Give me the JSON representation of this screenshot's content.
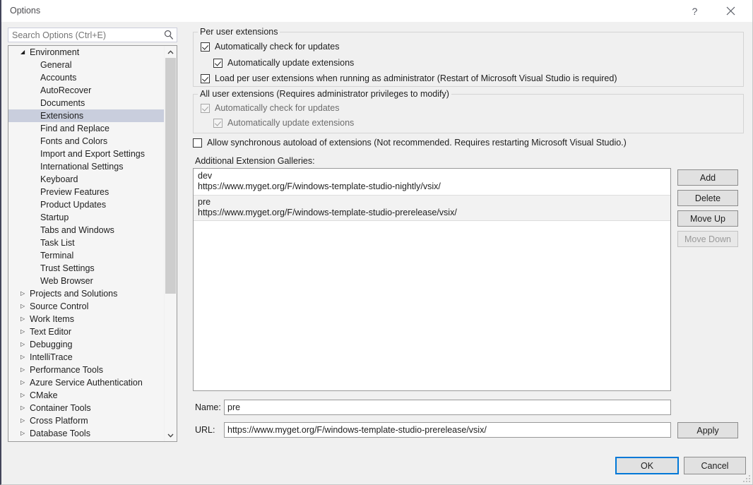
{
  "window": {
    "title": "Options",
    "help_icon": "question-mark-icon",
    "close_icon": "close-icon"
  },
  "search": {
    "placeholder": "Search Options (Ctrl+E)",
    "value": "",
    "icon": "search-icon"
  },
  "tree": {
    "items": [
      {
        "label": "Environment",
        "level": 0,
        "expanded": true,
        "arrow": "◢",
        "selected": false
      },
      {
        "label": "General",
        "level": 1,
        "arrow": "",
        "selected": false
      },
      {
        "label": "Accounts",
        "level": 1,
        "arrow": "",
        "selected": false
      },
      {
        "label": "AutoRecover",
        "level": 1,
        "arrow": "",
        "selected": false
      },
      {
        "label": "Documents",
        "level": 1,
        "arrow": "",
        "selected": false
      },
      {
        "label": "Extensions",
        "level": 1,
        "arrow": "",
        "selected": true
      },
      {
        "label": "Find and Replace",
        "level": 1,
        "arrow": "",
        "selected": false
      },
      {
        "label": "Fonts and Colors",
        "level": 1,
        "arrow": "",
        "selected": false
      },
      {
        "label": "Import and Export Settings",
        "level": 1,
        "arrow": "",
        "selected": false
      },
      {
        "label": "International Settings",
        "level": 1,
        "arrow": "",
        "selected": false
      },
      {
        "label": "Keyboard",
        "level": 1,
        "arrow": "",
        "selected": false
      },
      {
        "label": "Preview Features",
        "level": 1,
        "arrow": "",
        "selected": false
      },
      {
        "label": "Product Updates",
        "level": 1,
        "arrow": "",
        "selected": false
      },
      {
        "label": "Startup",
        "level": 1,
        "arrow": "",
        "selected": false
      },
      {
        "label": "Tabs and Windows",
        "level": 1,
        "arrow": "",
        "selected": false
      },
      {
        "label": "Task List",
        "level": 1,
        "arrow": "",
        "selected": false
      },
      {
        "label": "Terminal",
        "level": 1,
        "arrow": "",
        "selected": false
      },
      {
        "label": "Trust Settings",
        "level": 1,
        "arrow": "",
        "selected": false
      },
      {
        "label": "Web Browser",
        "level": 1,
        "arrow": "",
        "selected": false
      },
      {
        "label": "Projects and Solutions",
        "level": 0,
        "expanded": false,
        "arrow": "▷",
        "selected": false
      },
      {
        "label": "Source Control",
        "level": 0,
        "expanded": false,
        "arrow": "▷",
        "selected": false
      },
      {
        "label": "Work Items",
        "level": 0,
        "expanded": false,
        "arrow": "▷",
        "selected": false
      },
      {
        "label": "Text Editor",
        "level": 0,
        "expanded": false,
        "arrow": "▷",
        "selected": false
      },
      {
        "label": "Debugging",
        "level": 0,
        "expanded": false,
        "arrow": "▷",
        "selected": false
      },
      {
        "label": "IntelliTrace",
        "level": 0,
        "expanded": false,
        "arrow": "▷",
        "selected": false
      },
      {
        "label": "Performance Tools",
        "level": 0,
        "expanded": false,
        "arrow": "▷",
        "selected": false
      },
      {
        "label": "Azure Service Authentication",
        "level": 0,
        "expanded": false,
        "arrow": "▷",
        "selected": false
      },
      {
        "label": "CMake",
        "level": 0,
        "expanded": false,
        "arrow": "▷",
        "selected": false
      },
      {
        "label": "Container Tools",
        "level": 0,
        "expanded": false,
        "arrow": "▷",
        "selected": false
      },
      {
        "label": "Cross Platform",
        "level": 0,
        "expanded": false,
        "arrow": "▷",
        "selected": false
      },
      {
        "label": "Database Tools",
        "level": 0,
        "expanded": false,
        "arrow": "▷",
        "selected": false
      }
    ],
    "scroll_up_icon": "chevron-up-icon",
    "scroll_down_icon": "chevron-down-icon"
  },
  "per_user_group": {
    "label": "Per user extensions",
    "checkboxes": [
      {
        "label": "Automatically check for updates",
        "checked": true,
        "disabled": false
      },
      {
        "label": "Automatically update extensions",
        "checked": true,
        "disabled": false
      },
      {
        "label": "Load per user extensions when running as administrator (Restart of Microsoft Visual Studio is required)",
        "checked": true,
        "disabled": false
      }
    ]
  },
  "all_user_group": {
    "label": "All user extensions (Requires administrator privileges to modify)",
    "checkboxes": [
      {
        "label": "Automatically check for updates",
        "checked": true,
        "disabled": true
      },
      {
        "label": "Automatically update extensions",
        "checked": true,
        "disabled": true
      }
    ]
  },
  "autoload": {
    "label": "Allow synchronous autoload of extensions (Not recommended. Requires restarting Microsoft Visual Studio.)",
    "checked": false,
    "disabled": false
  },
  "galleries": {
    "section_label": "Additional Extension Galleries:",
    "items": [
      {
        "name": "dev",
        "url": "https://www.myget.org/F/windows-template-studio-nightly/vsix/",
        "selected": false
      },
      {
        "name": "pre",
        "url": "https://www.myget.org/F/windows-template-studio-prerelease/vsix/",
        "selected": true
      }
    ],
    "buttons": [
      {
        "label": "Add",
        "disabled": false
      },
      {
        "label": "Delete",
        "disabled": false
      },
      {
        "label": "Move Up",
        "disabled": false
      },
      {
        "label": "Move Down",
        "disabled": true
      }
    ]
  },
  "fields": {
    "name_label": "Name:",
    "name_value": "pre",
    "url_label": "URL:",
    "url_value": "https://www.myget.org/F/windows-template-studio-prerelease/vsix/",
    "apply_label": "Apply"
  },
  "footer": {
    "ok_label": "OK",
    "cancel_label": "Cancel"
  },
  "colors": {
    "accent": "#0078d7",
    "dialog_background": "#f0f0f0",
    "selection": "#c9cedd",
    "list_selection": "#f2f2f2"
  }
}
